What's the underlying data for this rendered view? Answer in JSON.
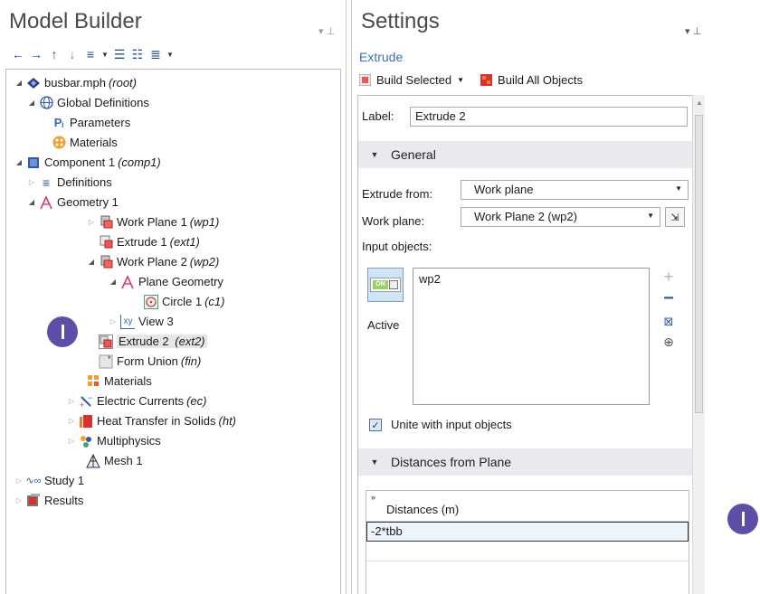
{
  "model_builder": {
    "title": "Model Builder",
    "toolbar": [
      {
        "icon": "back-arrow-icon"
      },
      {
        "icon": "forward-arrow-icon"
      },
      {
        "icon": "move-up-icon"
      },
      {
        "icon": "move-down-icon"
      },
      {
        "icon": "filter-icon"
      },
      {
        "icon": "expand-all-icon"
      },
      {
        "icon": "collapse-all-icon"
      },
      {
        "icon": "list-icon"
      }
    ],
    "tree": [
      {
        "label": "busbar.mph",
        "tag": "(root)",
        "icon": "root-icon"
      },
      {
        "label": "Global Definitions",
        "icon": "globe-icon"
      },
      {
        "label": "Parameters",
        "icon": "parameters-icon"
      },
      {
        "label": "Materials",
        "icon": "materials-icon"
      },
      {
        "label": "Component 1",
        "tag": "(comp1)",
        "icon": "component-icon"
      },
      {
        "label": "Definitions",
        "icon": "definitions-icon"
      },
      {
        "label": "Geometry 1",
        "icon": "geometry-icon"
      },
      {
        "label": "Work Plane 1",
        "tag": "(wp1)",
        "icon": "work-plane-icon"
      },
      {
        "label": "Extrude 1",
        "tag": "(ext1)",
        "icon": "extrude-icon"
      },
      {
        "label": "Work Plane 2",
        "tag": "(wp2)",
        "icon": "work-plane-icon"
      },
      {
        "label": "Plane Geometry",
        "icon": "plane-geometry-icon"
      },
      {
        "label": "Circle 1",
        "tag": "(c1)",
        "icon": "circle-icon"
      },
      {
        "label": "View 3",
        "icon": "view-icon"
      },
      {
        "label": "Extrude 2",
        "tag": "(ext2)",
        "icon": "extrude-icon",
        "selected": true
      },
      {
        "label": "Form Union",
        "tag": "(fin)",
        "icon": "form-union-icon"
      },
      {
        "label": "Materials",
        "icon": "materials-node-icon"
      },
      {
        "label": "Electric Currents",
        "tag": "(ec)",
        "icon": "electric-currents-icon"
      },
      {
        "label": "Heat Transfer in Solids",
        "tag": "(ht)",
        "icon": "heat-transfer-icon"
      },
      {
        "label": "Multiphysics",
        "icon": "multiphysics-icon"
      },
      {
        "label": "Mesh 1",
        "icon": "mesh-icon"
      },
      {
        "label": "Study 1",
        "icon": "study-icon"
      },
      {
        "label": "Results",
        "icon": "results-icon"
      }
    ]
  },
  "settings": {
    "title": "Settings",
    "subtitle": "Extrude",
    "build_selected": "Build Selected",
    "build_all": "Build All Objects",
    "label_caption": "Label:",
    "label_value": "Extrude 2",
    "general_header": "General",
    "extrude_from_caption": "Extrude from:",
    "extrude_from_value": "Work plane",
    "work_plane_caption": "Work plane:",
    "work_plane_value": "Work Plane 2 (wp2)",
    "input_objects_caption": "Input objects:",
    "toggle_on": "ON",
    "active_label": "Active",
    "input_objects": [
      "wp2"
    ],
    "unite_label": "Unite with input objects",
    "unite_checked": true,
    "distances_header": "Distances from Plane",
    "distances_column": "Distances (m)",
    "distances": [
      "-2*tbb"
    ]
  },
  "colors": {
    "title_gray": "#4a4a4a",
    "link_blue": "#3b6fb6",
    "section_bg": "#e8eaed",
    "marker_purple": "#5c4fa8"
  }
}
